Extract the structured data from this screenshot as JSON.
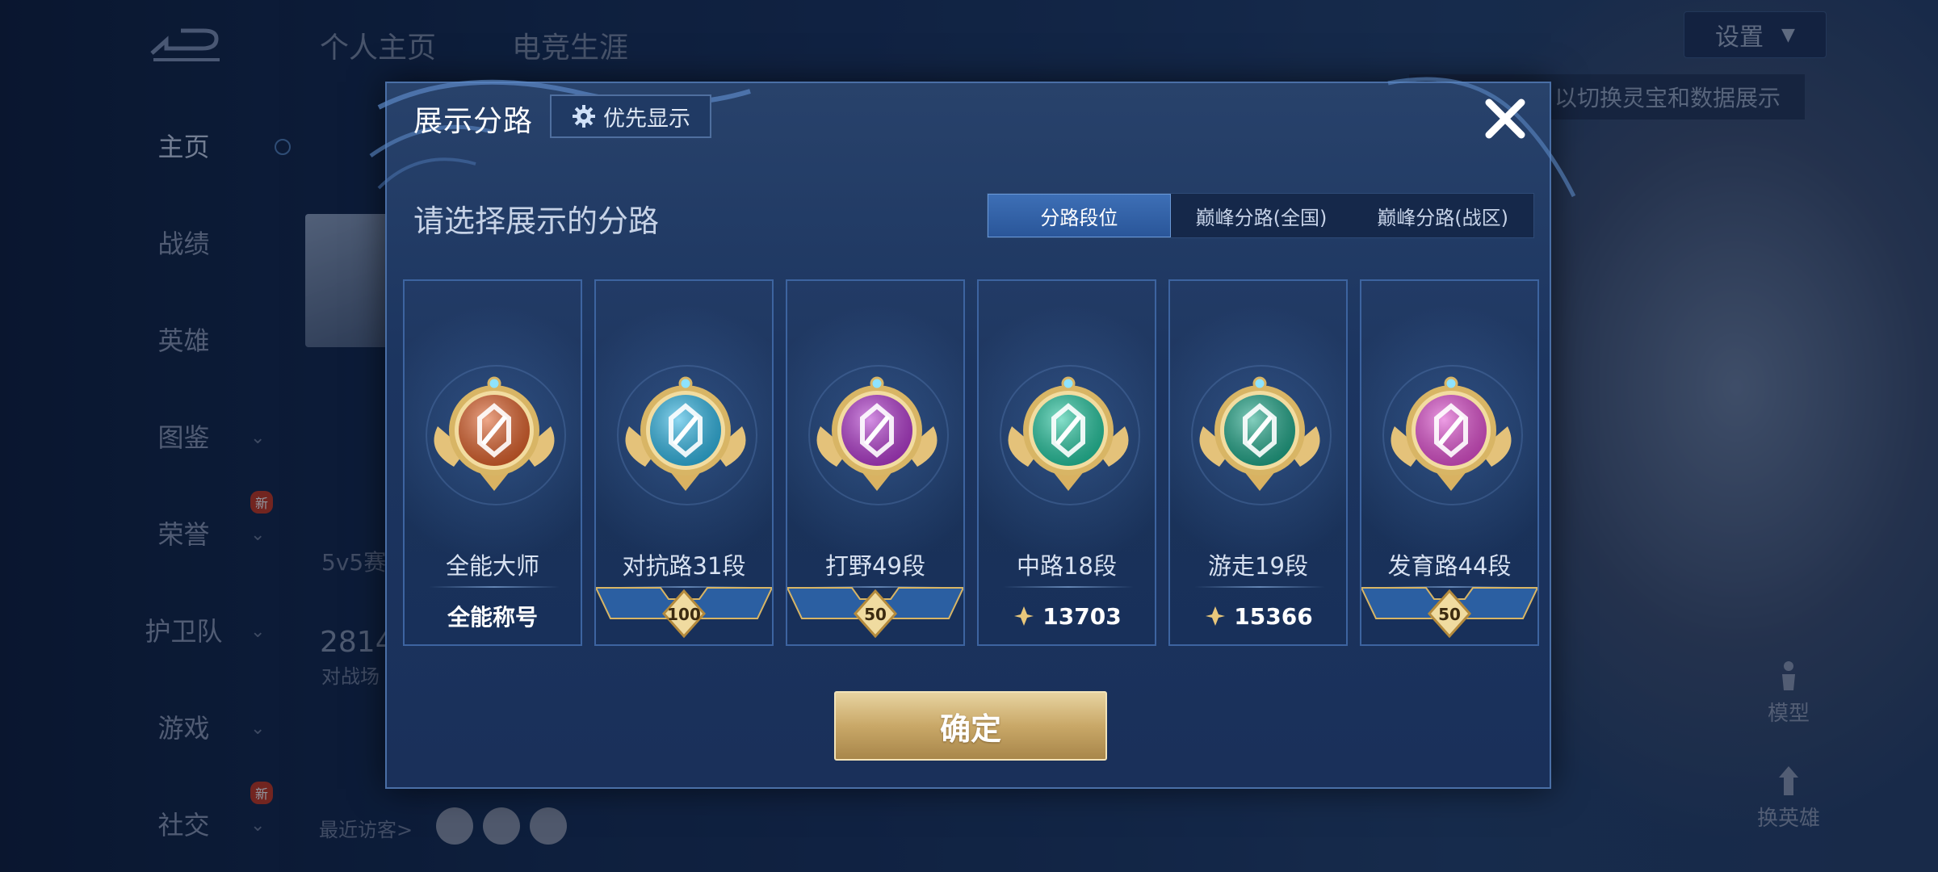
{
  "background": {
    "top_tabs": [
      "个人主页",
      "电竞生涯"
    ],
    "settings_label": "设置",
    "hint_text": "以切换灵宝和数据展示",
    "sidebar": {
      "items": [
        {
          "label": "主页"
        },
        {
          "label": "战绩"
        },
        {
          "label": "英雄"
        },
        {
          "label": "图鉴"
        },
        {
          "label": "荣誉",
          "badge": "新"
        },
        {
          "label": "护卫队"
        },
        {
          "label": "游戏"
        },
        {
          "label": "社交",
          "badge": "新"
        }
      ]
    },
    "stats_partial": {
      "mode_label": "5v5赛",
      "number": "2814",
      "sub": "对战场"
    },
    "visitors_label": "最近访客>",
    "right_controls": [
      {
        "label": "模型"
      },
      {
        "label": "换英雄"
      }
    ]
  },
  "modal": {
    "title": "展示分路",
    "priority_button": "优先显示",
    "subtitle": "请选择展示的分路",
    "segments": [
      {
        "label": "分路段位",
        "active": true
      },
      {
        "label": "巅峰分路(全国)",
        "active": false
      },
      {
        "label": "巅峰分路(战区)",
        "active": false
      }
    ],
    "cards": [
      {
        "name": "全能大师",
        "bottom_type": "title",
        "bottom_text": "全能称号",
        "emblem": "allround-emblem-icon",
        "color": "#e0612a"
      },
      {
        "name": "对抗路31段",
        "bottom_type": "stars",
        "bottom_text": "100",
        "emblem": "clash-lane-emblem-icon",
        "color": "#2fb7e6"
      },
      {
        "name": "打野49段",
        "bottom_type": "stars",
        "bottom_text": "50",
        "emblem": "jungle-emblem-icon",
        "color": "#b43ad0"
      },
      {
        "name": "中路18段",
        "bottom_type": "score",
        "bottom_text": "13703",
        "emblem": "mid-lane-emblem-icon",
        "color": "#23c7a0"
      },
      {
        "name": "游走19段",
        "bottom_type": "score",
        "bottom_text": "15366",
        "emblem": "roam-emblem-icon",
        "color": "#1fa88a"
      },
      {
        "name": "发育路44段",
        "bottom_type": "stars",
        "bottom_text": "50",
        "emblem": "farm-lane-emblem-icon",
        "color": "#e04fd0"
      }
    ],
    "confirm_button": "确定"
  }
}
